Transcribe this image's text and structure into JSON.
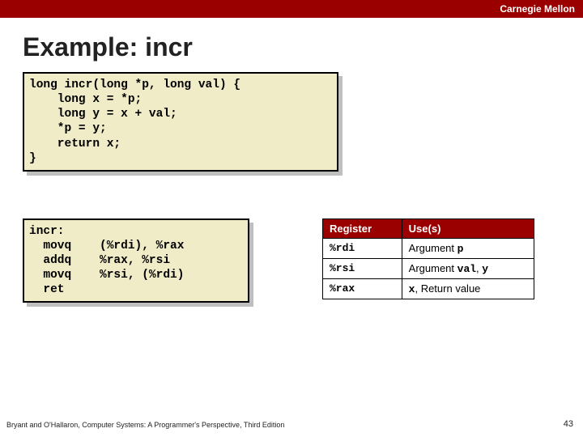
{
  "header": {
    "org": "Carnegie Mellon"
  },
  "title": "Example: incr",
  "code_c": "long incr(long *p, long val) {\n    long x = *p;\n    long y = x + val;\n    *p = y;\n    return x;\n}",
  "code_asm": "incr:\n  movq    (%rdi), %rax\n  addq    %rax, %rsi\n  movq    %rsi, (%rdi)\n  ret",
  "table": {
    "headers": [
      "Register",
      "Use(s)"
    ],
    "rows": [
      {
        "reg": "%rdi",
        "use_pre": "Argument ",
        "use_mono": "p",
        "use_post": ""
      },
      {
        "reg": "%rsi",
        "use_pre": "Argument ",
        "use_mono": "val",
        "use_post": ", ",
        "use_mono2": "y"
      },
      {
        "reg": "%rax",
        "use_pre": "",
        "use_mono": "x",
        "use_post": ", Return value"
      }
    ]
  },
  "footer": "Bryant and O'Hallaron, Computer Systems: A Programmer's Perspective, Third Edition",
  "page": "43"
}
